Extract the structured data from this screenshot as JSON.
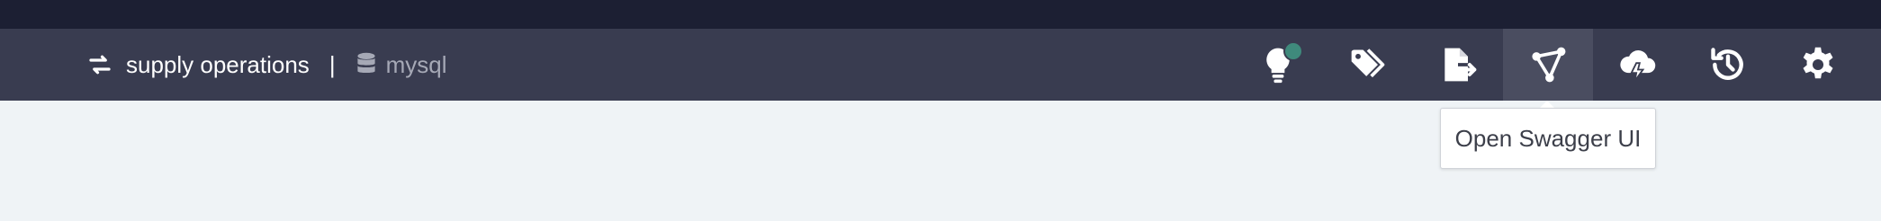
{
  "breadcrumb": {
    "workspace": "supply operations",
    "separator": "|",
    "database": "mysql"
  },
  "toolbar": {
    "buttons": [
      {
        "name": "tips-button",
        "icon": "lightbulb-icon",
        "badge": true
      },
      {
        "name": "tags-button",
        "icon": "tags-icon"
      },
      {
        "name": "export-button",
        "icon": "file-export-icon"
      },
      {
        "name": "swagger-button",
        "icon": "swagger-share-icon",
        "active": true
      },
      {
        "name": "cloud-deploy-button",
        "icon": "cloud-bolt-icon"
      },
      {
        "name": "history-button",
        "icon": "history-icon"
      },
      {
        "name": "settings-button",
        "icon": "gear-icon"
      }
    ]
  },
  "tooltip": {
    "text": "Open Swagger UI"
  },
  "colors": {
    "top_strip": "#1c1f33",
    "toolbar": "#393c50",
    "toolbar_active": "#4a4d60",
    "badge": "#3f8a7c",
    "page_bg": "#eff3f6"
  }
}
